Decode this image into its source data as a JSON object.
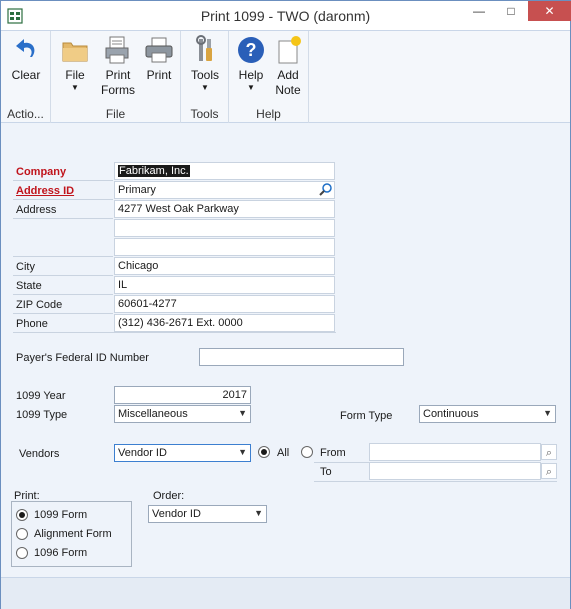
{
  "window": {
    "title": "Print 1099  -  TWO (daronm)",
    "min_glyph": "—",
    "max_glyph": "□",
    "close_glyph": "✕"
  },
  "ribbon": {
    "groups": [
      {
        "label": "Actio...",
        "buttons": [
          {
            "label": "Clear",
            "icon": "undo-arrow-icon"
          }
        ]
      },
      {
        "label": "File",
        "buttons": [
          {
            "label": "File",
            "icon": "folder-icon",
            "dropdown": true
          },
          {
            "label": "Print",
            "label2": "Forms",
            "icon": "print-forms-icon"
          },
          {
            "label": "Print",
            "icon": "printer-icon"
          }
        ]
      },
      {
        "label": "Tools",
        "buttons": [
          {
            "label": "Tools",
            "icon": "tools-icon",
            "dropdown": true
          }
        ]
      },
      {
        "label": "Help",
        "buttons": [
          {
            "label": "Help",
            "icon": "help-icon",
            "dropdown": true
          },
          {
            "label": "Add",
            "label2": "Note",
            "icon": "note-icon"
          }
        ]
      }
    ],
    "dropdown_glyph": "▼"
  },
  "company_block": {
    "company_label": "Company",
    "company_value": "Fabrikam, Inc.",
    "address_id_label": "Address ID",
    "address_id_value": "Primary",
    "address_label": "Address",
    "address_line1": "4277 West Oak Parkway",
    "address_line2": "",
    "address_line3": "",
    "city_label": "City",
    "city_value": "Chicago",
    "state_label": "State",
    "state_value": "IL",
    "zip_label": "ZIP Code",
    "zip_value": "60601-4277",
    "phone_label": "Phone",
    "phone_value": "(312) 436-2671  Ext. 0000"
  },
  "payer": {
    "federal_id_label": "Payer's Federal ID Number",
    "federal_id_value": ""
  },
  "year_type": {
    "year_label": "1099 Year",
    "year_value": "2017",
    "type_label": "1099 Type",
    "type_value": "Miscellaneous",
    "form_type_label": "Form Type",
    "form_type_value": "Continuous"
  },
  "vendors": {
    "label": "Vendors",
    "select_value": "Vendor ID",
    "all_label": "All",
    "from_label": "From",
    "to_label": "To",
    "from_value": "",
    "to_value": "",
    "selected": "All"
  },
  "print_group": {
    "label": "Print:",
    "options": [
      "1099 Form",
      "Alignment Form",
      "1096 Form"
    ],
    "selected": "1099 Form"
  },
  "order": {
    "label": "Order:",
    "value": "Vendor ID"
  }
}
